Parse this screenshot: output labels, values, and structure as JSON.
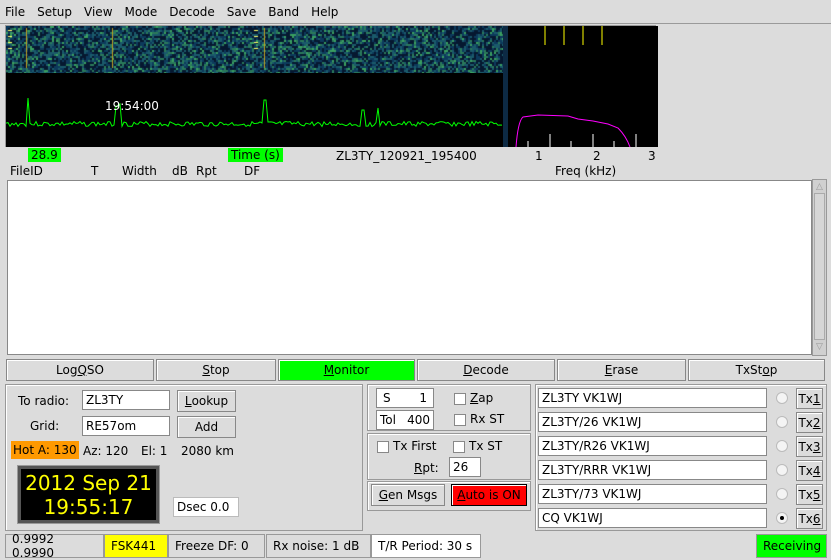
{
  "menu": [
    "File",
    "Setup",
    "View",
    "Mode",
    "Decode",
    "Save",
    "Band",
    "Help"
  ],
  "graph": {
    "time_label": "19:54:00",
    "level_value": "28.9",
    "time_axis_label": "Time (s)",
    "file_name": "ZL3TY_120921_195400",
    "freq_ticks": [
      "1",
      "2",
      "3"
    ],
    "freq_axis_label": "Freq (kHz)"
  },
  "columns": {
    "fileid": "FileID",
    "t": "T",
    "width": "Width",
    "db": "dB",
    "rpt": "Rpt",
    "df": "DF"
  },
  "decoded_text": "",
  "buttons": {
    "log_qso": {
      "pre": "Log ",
      "u": "Q",
      "post": "SO"
    },
    "stop": {
      "pre": "",
      "u": "S",
      "post": "top"
    },
    "monitor": {
      "pre": "",
      "u": "M",
      "post": "onitor"
    },
    "decode": {
      "pre": "",
      "u": "D",
      "post": "ecode"
    },
    "erase": {
      "pre": "",
      "u": "E",
      "post": "rase"
    },
    "txstop": {
      "pre": "TxSt",
      "u": "o",
      "post": "p"
    }
  },
  "station": {
    "to_radio_label": "To radio:",
    "to_radio_value": "ZL3TY",
    "lookup_pre": "",
    "lookup_u": "L",
    "lookup_post": "ookup",
    "grid_label": "Grid:",
    "grid_value": "RE57om",
    "add_label": "Add",
    "hot_a": "Hot A: 130",
    "az": "Az: 120",
    "el": "El: 1",
    "distance": "2080 km",
    "clock_date": "2012 Sep 21",
    "clock_time": "19:55:17",
    "dsec": "Dsec  0.0"
  },
  "controls": {
    "s_label": "S",
    "s_value": "1",
    "tol_label": "Tol",
    "tol_value": "400",
    "zap_u": "Z",
    "zap_post": "ap",
    "rx_st": "Rx ST",
    "tx_first": "Tx First",
    "tx_st": "Tx ST",
    "rpt_u": "R",
    "rpt_post": "pt:",
    "rpt_value": "26",
    "gen_msgs_u": "G",
    "gen_msgs_post": "en Msgs",
    "auto_u": "A",
    "auto_post": "uto is  ON"
  },
  "tx_messages": [
    {
      "text": "ZL3TY VK1WJ",
      "btn_pre": "Tx",
      "btn_u": "1",
      "selected": false
    },
    {
      "text": "ZL3TY/26 VK1WJ",
      "btn_pre": "Tx",
      "btn_u": "2",
      "selected": false
    },
    {
      "text": "ZL3TY/R26 VK1WJ",
      "btn_pre": "Tx",
      "btn_u": "3",
      "selected": false
    },
    {
      "text": "ZL3TY/RRR VK1WJ",
      "btn_pre": "Tx",
      "btn_u": "4",
      "selected": false
    },
    {
      "text": "ZL3TY/73  VK1WJ",
      "btn_pre": "Tx",
      "btn_u": "5",
      "selected": false
    },
    {
      "text": "CQ VK1WJ",
      "btn_pre": "Tx",
      "btn_u": "6",
      "selected": true
    }
  ],
  "status": {
    "ratios": "0.9992 0.9990",
    "mode": "FSK441",
    "freeze_df": "Freeze DF:   0",
    "rx_noise": "Rx noise:  1 dB",
    "tr_period": "T/R Period: 30 s",
    "state": "Receiving"
  },
  "colors": {
    "monitor_on": "#00ff00",
    "auto_on": "#ff0000",
    "hot_a": "#ff9900",
    "mode_badge": "#ffff00",
    "receiving": "#00ff00",
    "clock_text": "#ffff00",
    "timeplot_trace": "#00ff00",
    "spectrum_trace": "#ff00ff"
  }
}
